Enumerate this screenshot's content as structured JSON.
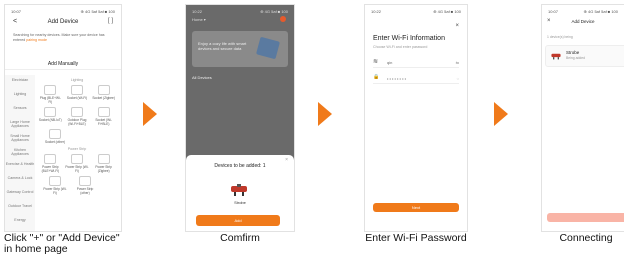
{
  "phone1": {
    "status_time": "10:07",
    "status_right": "⊕ 4G 5af 5af ■ 100",
    "back_glyph": "<",
    "title": "Add Device",
    "scan_glyph": "[ ]",
    "notice_text": "Searching for nearby devices. Make sure your device has entered",
    "notice_link": "pairing mode",
    "manual_label": "Add Manually",
    "sidebar": [
      "Electrician",
      "Lighting",
      "Sensors",
      "Large Home Appliances",
      "Small Home Appliances",
      "Kitchen Appliances",
      "Exercise & Health",
      "Camera & Lock",
      "Gateway Control",
      "Outdoor Travel",
      "Energy"
    ],
    "group_lighting": "Lighting",
    "group_strip": "Power Strip",
    "items_row1": [
      "Plug (BLE+Wi-Fi)",
      "Socket (Wi-Fi)",
      "Socket (Zigbee)"
    ],
    "items_row2": [
      "Socket (NB-IoT)",
      "Outdoor Plug (Wi-Fi+BLE)",
      "Socket (Wi-Fi+BLE)"
    ],
    "items_row3": [
      "Socket (other)"
    ],
    "items_row4": [
      "Power Strip (BLE+Wi-Fi)",
      "Power Strip (Wi-Fi)",
      "Power Strip (Zigbee)"
    ],
    "items_row5": [
      "Power Strip (Wi-Fi)",
      "Power Strip (other)"
    ]
  },
  "phone2": {
    "status_time": "10:22",
    "status_right": "⊕ 4G 5af ■ 100",
    "topbar": "Home ▾",
    "card_text": "Enjoy a cozy life with smart devices and secure data",
    "all_devices": "All Devices",
    "sheet_title": "Devices to be added: 1",
    "close_glyph": "×",
    "device_name": "Strobe",
    "add_label": "Add"
  },
  "phone3": {
    "status_time": "10:22",
    "status_right": "⊕ 4G 5af ■ 100",
    "close_glyph": "×",
    "title": "Enter Wi-Fi Information",
    "subtitle": "Choose Wi-Fi and enter password",
    "wifi_glyph": "≋",
    "wifi_value": "qin",
    "wifi_right": "⇆",
    "pwd_glyph": "🔒",
    "pwd_value": "• • • • • • • •",
    "pwd_right": "◌",
    "next_label": "Next"
  },
  "phone4": {
    "status_time": "10:07",
    "status_right": "⊕ 4G 5af 5af ■ 100",
    "close_glyph": "×",
    "title": "Add Device",
    "section": "1 device(s) being",
    "device_name": "Strobe",
    "device_status": "Being added"
  },
  "captions": {
    "c1_line1": "Click \"+\" or \"Add Device\"",
    "c1_line2": "in home page",
    "c2": "Comfirm",
    "c3": "Enter Wi-Fi Password",
    "c4": "Connecting"
  },
  "colors": {
    "accent": "#f07a1a",
    "overlay": "#6a6a6a"
  }
}
